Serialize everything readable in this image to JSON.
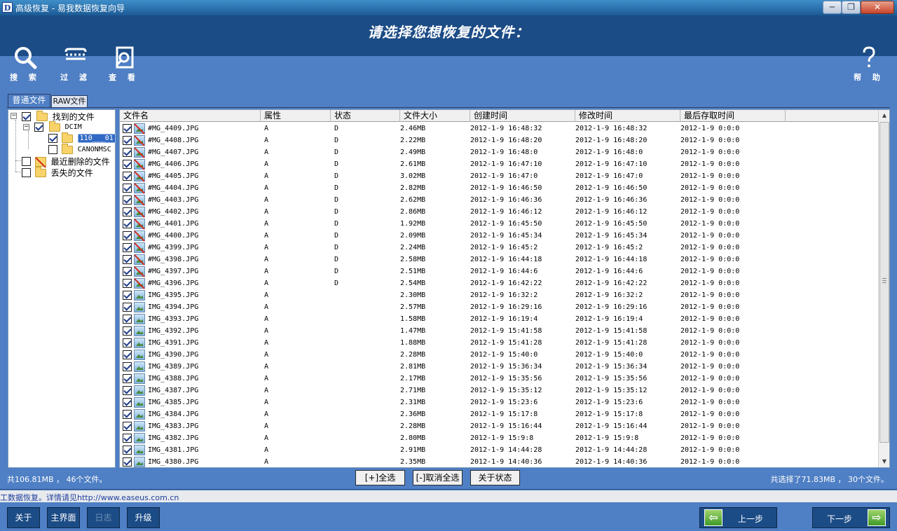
{
  "window": {
    "title": "高级恢复 - 易我数据恢复向导",
    "app_icon": "D",
    "min": "─",
    "max": "❐",
    "close": "✕"
  },
  "header": {
    "heading": "请选择您想恢复的文件："
  },
  "toolbar": {
    "search": "搜 索",
    "filter": "过 滤",
    "view": "查 看",
    "help": "帮 助"
  },
  "tabs": {
    "normal": "普通文件",
    "raw": "RAW文件"
  },
  "tree": {
    "found": "找到的文件",
    "dcim": "DCIM",
    "folder110": "110___01",
    "canonmsc": "CANONMSC",
    "recent_deleted": "最近删除的文件",
    "lost": "丢失的文件"
  },
  "columns": {
    "name": "文件名",
    "attr": "属性",
    "state": "状态",
    "size": "文件大小",
    "created": "创建时间",
    "modified": "修改时间",
    "accessed": "最后存取时间"
  },
  "files": [
    {
      "name": "#MG_4409.JPG",
      "attr": "A",
      "state": "D",
      "size": "2.46MB",
      "created": "2012-1-9 16:48:32",
      "modified": "2012-1-9 16:48:32",
      "accessed": "2012-1-9 0:0:0"
    },
    {
      "name": "#MG_4408.JPG",
      "attr": "A",
      "state": "D",
      "size": "2.22MB",
      "created": "2012-1-9 16:48:20",
      "modified": "2012-1-9 16:48:20",
      "accessed": "2012-1-9 0:0:0"
    },
    {
      "name": "#MG_4407.JPG",
      "attr": "A",
      "state": "D",
      "size": "2.49MB",
      "created": "2012-1-9 16:48:0",
      "modified": "2012-1-9 16:48:0",
      "accessed": "2012-1-9 0:0:0"
    },
    {
      "name": "#MG_4406.JPG",
      "attr": "A",
      "state": "D",
      "size": "2.61MB",
      "created": "2012-1-9 16:47:10",
      "modified": "2012-1-9 16:47:10",
      "accessed": "2012-1-9 0:0:0"
    },
    {
      "name": "#MG_4405.JPG",
      "attr": "A",
      "state": "D",
      "size": "3.02MB",
      "created": "2012-1-9 16:47:0",
      "modified": "2012-1-9 16:47:0",
      "accessed": "2012-1-9 0:0:0"
    },
    {
      "name": "#MG_4404.JPG",
      "attr": "A",
      "state": "D",
      "size": "2.82MB",
      "created": "2012-1-9 16:46:50",
      "modified": "2012-1-9 16:46:50",
      "accessed": "2012-1-9 0:0:0"
    },
    {
      "name": "#MG_4403.JPG",
      "attr": "A",
      "state": "D",
      "size": "2.62MB",
      "created": "2012-1-9 16:46:36",
      "modified": "2012-1-9 16:46:36",
      "accessed": "2012-1-9 0:0:0"
    },
    {
      "name": "#MG_4402.JPG",
      "attr": "A",
      "state": "D",
      "size": "2.86MB",
      "created": "2012-1-9 16:46:12",
      "modified": "2012-1-9 16:46:12",
      "accessed": "2012-1-9 0:0:0"
    },
    {
      "name": "#MG_4401.JPG",
      "attr": "A",
      "state": "D",
      "size": "1.92MB",
      "created": "2012-1-9 16:45:50",
      "modified": "2012-1-9 16:45:50",
      "accessed": "2012-1-9 0:0:0"
    },
    {
      "name": "#MG_4400.JPG",
      "attr": "A",
      "state": "D",
      "size": "2.09MB",
      "created": "2012-1-9 16:45:34",
      "modified": "2012-1-9 16:45:34",
      "accessed": "2012-1-9 0:0:0"
    },
    {
      "name": "#MG_4399.JPG",
      "attr": "A",
      "state": "D",
      "size": "2.24MB",
      "created": "2012-1-9 16:45:2",
      "modified": "2012-1-9 16:45:2",
      "accessed": "2012-1-9 0:0:0"
    },
    {
      "name": "#MG_4398.JPG",
      "attr": "A",
      "state": "D",
      "size": "2.58MB",
      "created": "2012-1-9 16:44:18",
      "modified": "2012-1-9 16:44:18",
      "accessed": "2012-1-9 0:0:0"
    },
    {
      "name": "#MG_4397.JPG",
      "attr": "A",
      "state": "D",
      "size": "2.51MB",
      "created": "2012-1-9 16:44:6",
      "modified": "2012-1-9 16:44:6",
      "accessed": "2012-1-9 0:0:0"
    },
    {
      "name": "#MG_4396.JPG",
      "attr": "A",
      "state": "D",
      "size": "2.54MB",
      "created": "2012-1-9 16:42:22",
      "modified": "2012-1-9 16:42:22",
      "accessed": "2012-1-9 0:0:0"
    },
    {
      "name": "IMG_4395.JPG",
      "attr": "A",
      "state": "",
      "size": "2.30MB",
      "created": "2012-1-9 16:32:2",
      "modified": "2012-1-9 16:32:2",
      "accessed": "2012-1-9 0:0:0"
    },
    {
      "name": "IMG_4394.JPG",
      "attr": "A",
      "state": "",
      "size": "2.57MB",
      "created": "2012-1-9 16:29:16",
      "modified": "2012-1-9 16:29:16",
      "accessed": "2012-1-9 0:0:0"
    },
    {
      "name": "IMG_4393.JPG",
      "attr": "A",
      "state": "",
      "size": "1.58MB",
      "created": "2012-1-9 16:19:4",
      "modified": "2012-1-9 16:19:4",
      "accessed": "2012-1-9 0:0:0"
    },
    {
      "name": "IMG_4392.JPG",
      "attr": "A",
      "state": "",
      "size": "1.47MB",
      "created": "2012-1-9 15:41:58",
      "modified": "2012-1-9 15:41:58",
      "accessed": "2012-1-9 0:0:0"
    },
    {
      "name": "IMG_4391.JPG",
      "attr": "A",
      "state": "",
      "size": "1.88MB",
      "created": "2012-1-9 15:41:28",
      "modified": "2012-1-9 15:41:28",
      "accessed": "2012-1-9 0:0:0"
    },
    {
      "name": "IMG_4390.JPG",
      "attr": "A",
      "state": "",
      "size": "2.28MB",
      "created": "2012-1-9 15:40:0",
      "modified": "2012-1-9 15:40:0",
      "accessed": "2012-1-9 0:0:0"
    },
    {
      "name": "IMG_4389.JPG",
      "attr": "A",
      "state": "",
      "size": "2.81MB",
      "created": "2012-1-9 15:36:34",
      "modified": "2012-1-9 15:36:34",
      "accessed": "2012-1-9 0:0:0"
    },
    {
      "name": "IMG_4388.JPG",
      "attr": "A",
      "state": "",
      "size": "2.17MB",
      "created": "2012-1-9 15:35:56",
      "modified": "2012-1-9 15:35:56",
      "accessed": "2012-1-9 0:0:0"
    },
    {
      "name": "IMG_4387.JPG",
      "attr": "A",
      "state": "",
      "size": "2.71MB",
      "created": "2012-1-9 15:35:12",
      "modified": "2012-1-9 15:35:12",
      "accessed": "2012-1-9 0:0:0"
    },
    {
      "name": "IMG_4385.JPG",
      "attr": "A",
      "state": "",
      "size": "2.31MB",
      "created": "2012-1-9 15:23:6",
      "modified": "2012-1-9 15:23:6",
      "accessed": "2012-1-9 0:0:0"
    },
    {
      "name": "IMG_4384.JPG",
      "attr": "A",
      "state": "",
      "size": "2.36MB",
      "created": "2012-1-9 15:17:8",
      "modified": "2012-1-9 15:17:8",
      "accessed": "2012-1-9 0:0:0"
    },
    {
      "name": "IMG_4383.JPG",
      "attr": "A",
      "state": "",
      "size": "2.28MB",
      "created": "2012-1-9 15:16:44",
      "modified": "2012-1-9 15:16:44",
      "accessed": "2012-1-9 0:0:0"
    },
    {
      "name": "IMG_4382.JPG",
      "attr": "A",
      "state": "",
      "size": "2.80MB",
      "created": "2012-1-9 15:9:8",
      "modified": "2012-1-9 15:9:8",
      "accessed": "2012-1-9 0:0:0"
    },
    {
      "name": "IMG_4381.JPG",
      "attr": "A",
      "state": "",
      "size": "2.91MB",
      "created": "2012-1-9 14:44:28",
      "modified": "2012-1-9 14:44:28",
      "accessed": "2012-1-9 0:0:0"
    },
    {
      "name": "IMG_4380.JPG",
      "attr": "A",
      "state": "",
      "size": "2.35MB",
      "created": "2012-1-9 14:40:36",
      "modified": "2012-1-9 14:40:36",
      "accessed": "2012-1-9 0:0:0"
    }
  ],
  "status": {
    "total": "共106.81MB ， 46个文件。",
    "selected": "共选择了71.83MB ， 30个文件。"
  },
  "buttons": {
    "select_all": "[+]全选",
    "deselect_all": "[-]取消全选",
    "about_state": "关于状态"
  },
  "link_bar": "工数据恢复。详情请见http://www.easeus.com.cn",
  "footer": {
    "about": "关于",
    "main": "主界面",
    "log": "日志",
    "upgrade": "升级",
    "prev": "上一步",
    "next": "下一步"
  }
}
